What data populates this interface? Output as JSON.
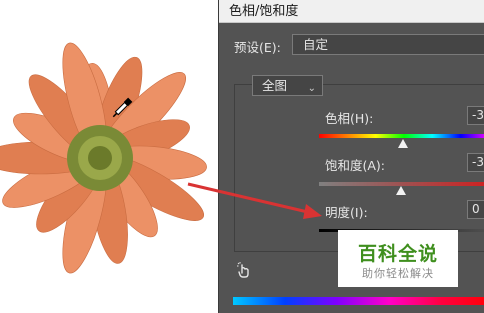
{
  "dialog": {
    "title": "色相/饱和度",
    "preset_label": "预设(E):",
    "preset_value": "自定",
    "channel_value": "全图",
    "hue_label": "色相(H):",
    "hue_value": "-3",
    "saturation_label": "饱和度(A):",
    "saturation_value": "-3",
    "lightness_label": "明度(I):",
    "lightness_value": "0"
  },
  "watermark": {
    "title": "百科全说",
    "subtitle": "助你轻松解决"
  },
  "colors": {
    "dialog_bg": "#535353",
    "petal": "#e8895c",
    "flower_center": "#7a8a36",
    "arrow": "#d93333",
    "watermark_green": "#3f8f1e"
  },
  "icons": {
    "channel_dropdown": "chevron-down-icon",
    "on_image_adjust": "hand-pointer-icon",
    "canvas_cursor": "eyedropper-icon"
  }
}
